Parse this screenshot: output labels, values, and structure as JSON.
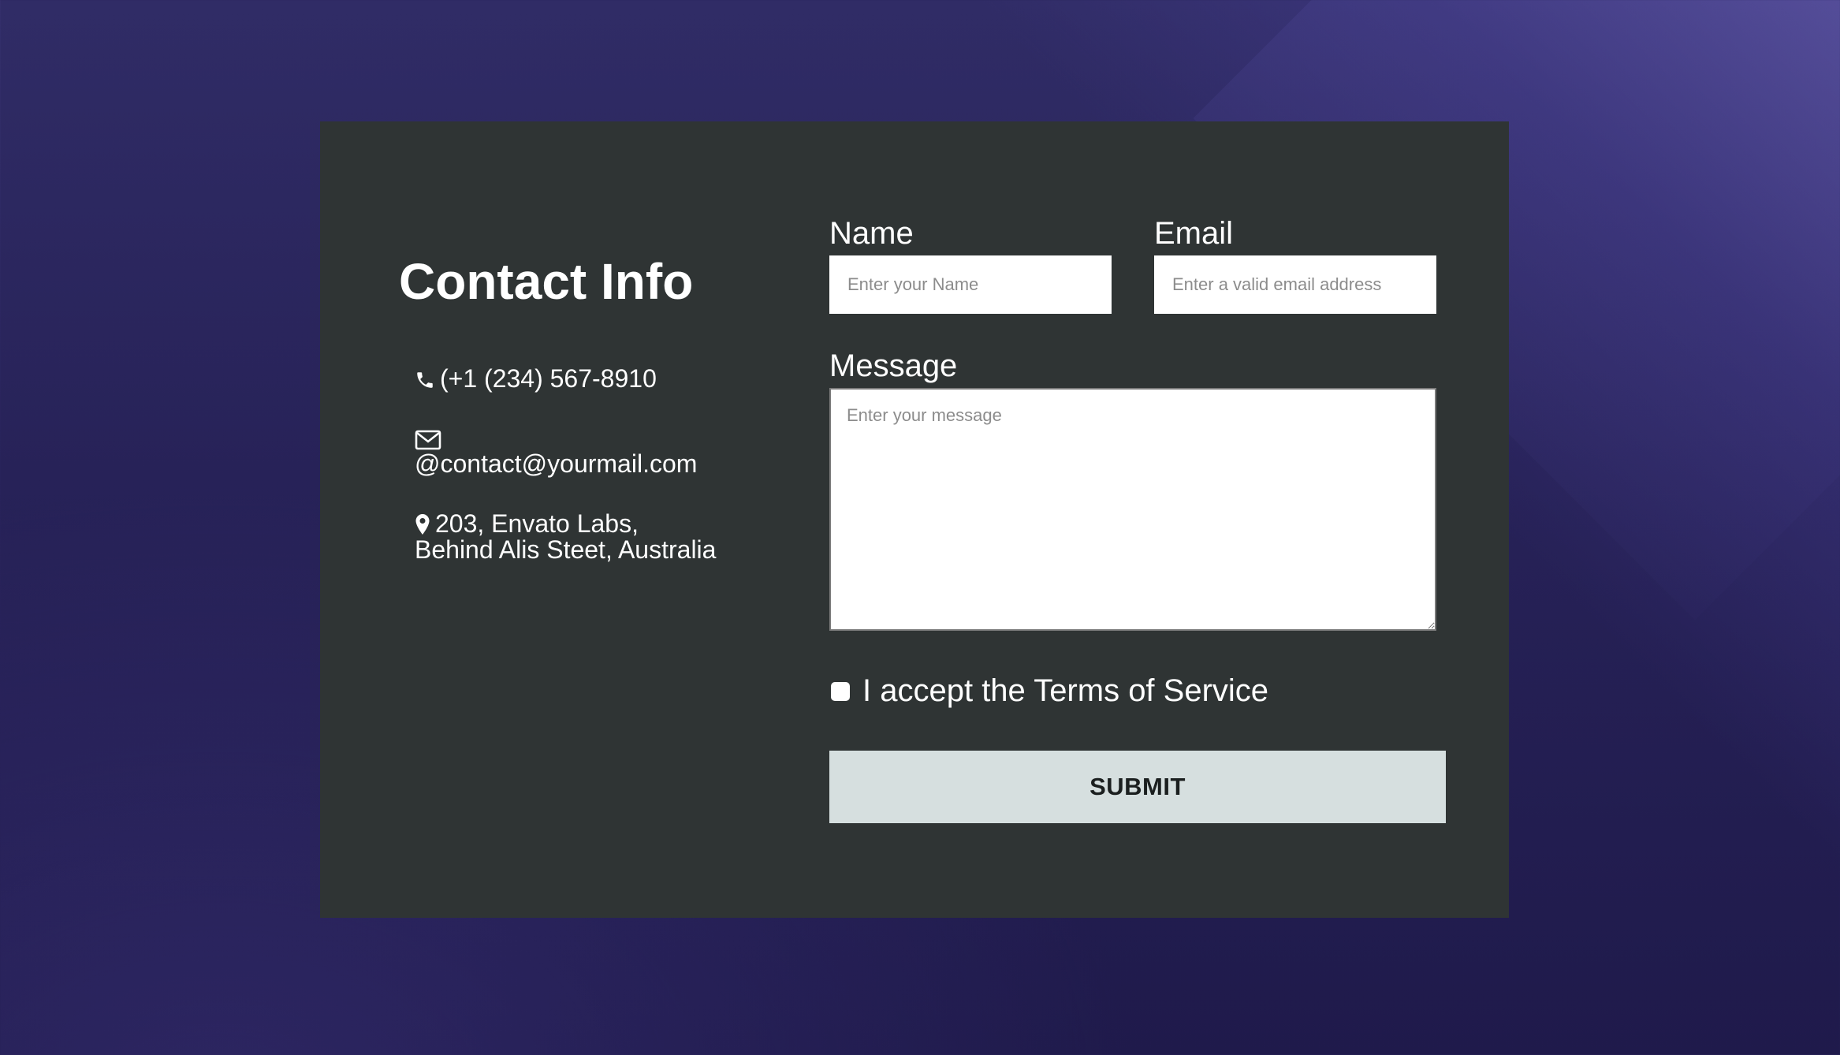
{
  "contact": {
    "heading": "Contact Info",
    "phone": "(+1 (234) 567-8910",
    "email": "@contact@yourmail.com",
    "address_line1": "203, Envato Labs,",
    "address_line2": "Behind Alis Steet, Australia",
    "icons": [
      "phone-icon",
      "envelope-icon",
      "map-pin-icon"
    ]
  },
  "form": {
    "name_label": "Name",
    "name_placeholder": "Enter your Name",
    "email_label": "Email",
    "email_placeholder": "Enter a valid email address",
    "message_label": "Message",
    "message_placeholder": "Enter your message",
    "terms_label": "I accept the Terms of Service",
    "submit_label": "SUBMIT"
  },
  "colors": {
    "background": "#272258",
    "card": "#2f3434",
    "submit": "#d6dfdf",
    "text": "#ffffff"
  }
}
